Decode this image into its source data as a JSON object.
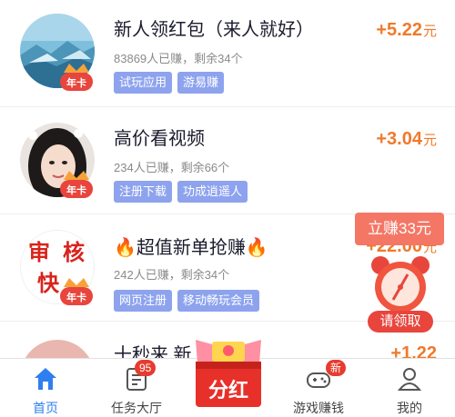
{
  "tasks": [
    {
      "title": "新人领红包（来人就好）",
      "stats": "83869人已赚，剩余34个",
      "tags": [
        "试玩应用",
        "游易赚"
      ],
      "reward": "+5.22",
      "unit": "元",
      "badge": "年卡"
    },
    {
      "title": "高价看视频",
      "stats": "234人已赚，剩余66个",
      "tags": [
        "注册下载",
        "功成逍遥人"
      ],
      "reward": "+3.04",
      "unit": "元",
      "badge": "年卡"
    },
    {
      "title": "🔥超值新单抢赚🔥",
      "stats": "242人已赚，剩余34个",
      "tags": [
        "网页注册",
        "移动畅玩会员"
      ],
      "reward": "+22.00",
      "unit": "元",
      "badge": "年卡",
      "avatar_chars": [
        "审",
        "核",
        "快"
      ]
    },
    {
      "title": "十秒来  新  赚",
      "reward": "+1.22"
    }
  ],
  "promo": {
    "pill": "立赚33元",
    "claim": "请领取"
  },
  "tabbar": {
    "home": "首页",
    "tasks": "任务大厅",
    "tasks_badge": "95",
    "center": "分红",
    "games": "游戏赚钱",
    "games_badge": "新",
    "mine": "我的"
  },
  "colors": {
    "accent": "#2f7ff0",
    "reward": "#ef7a2a",
    "tag": "#8ea3ee",
    "badge": "#e63b2e"
  }
}
